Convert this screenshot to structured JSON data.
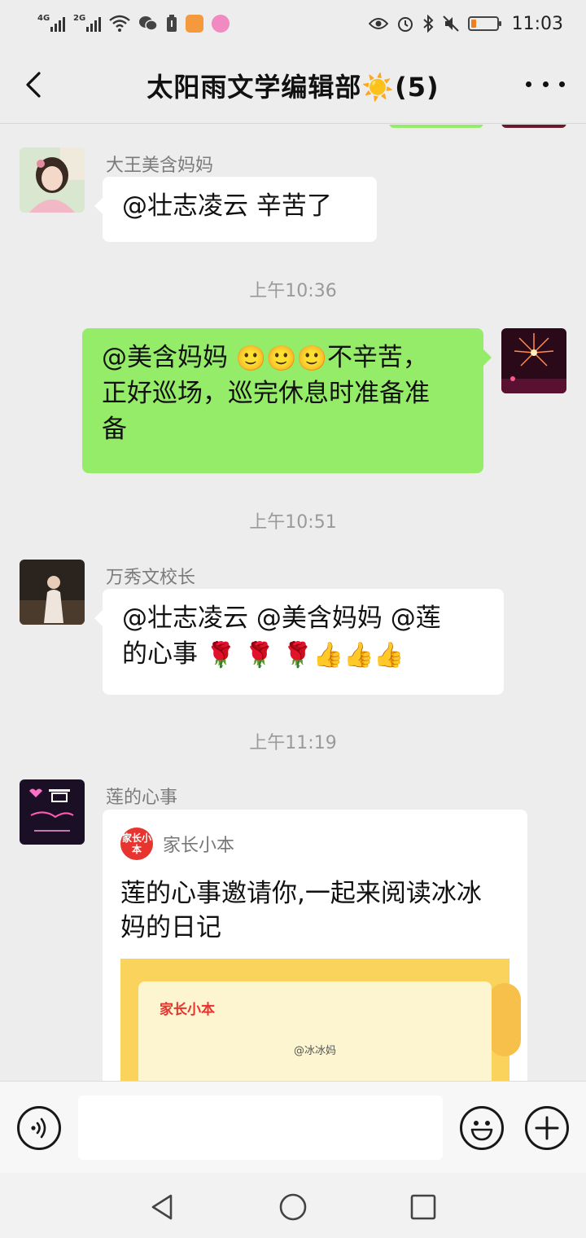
{
  "status_bar": {
    "net1": "4G",
    "net2": "2G",
    "time": "11:03",
    "battery_percent": 20,
    "battery_color": "#f07f22",
    "icons": [
      "signal-icon",
      "signal-icon",
      "wifi-icon",
      "wechat-icon",
      "battery-saver-icon",
      "uc-browser-icon",
      "app-badge-icon",
      "eye-icon",
      "alarm-icon",
      "bluetooth-icon",
      "mute-icon",
      "battery-icon"
    ]
  },
  "header": {
    "title": "太阳雨文学编辑部☀️(5)",
    "back_icon": "chevron-left-icon",
    "more_icon": "more-dots-icon"
  },
  "messages": [
    {
      "sender": "大王美含妈妈",
      "text": "@壮志凌云  辛苦了",
      "side": "left"
    },
    {
      "time": "上午10:36"
    },
    {
      "sender": "me",
      "text_line1": "@美含妈妈 ",
      "emojis1": [
        "🙂",
        "🙂",
        "🙂"
      ],
      "text_line1_end": "不辛苦，",
      "text_line2": "正好巡场，巡完休息时准备准",
      "text_line3": "备",
      "side": "right"
    },
    {
      "time": "上午10:51"
    },
    {
      "sender": "万秀文校长",
      "text_line1": "@壮志凌云  @美含妈妈  @莲",
      "text_line2": "的心事 ",
      "emojis": [
        "🌹",
        "🌹",
        "🌹",
        "👍",
        "👍",
        "👍"
      ],
      "side": "left"
    },
    {
      "time": "上午11:19"
    },
    {
      "sender": "莲的心事",
      "side": "left",
      "card": {
        "source_name": "家长小本",
        "logo_text": "家长小本",
        "title": "莲的心事邀请你,一起来阅读冰冰妈的日记",
        "thumb_brand": "家长小本",
        "thumb_handle": "@冰冰妈"
      }
    }
  ],
  "input_bar": {
    "placeholder": "",
    "voice_icon": "voice-icon",
    "emoji_icon": "emoji-icon",
    "plus_icon": "plus-icon"
  },
  "nav_bar": {
    "back_icon": "nav-back-icon",
    "home_icon": "nav-home-icon",
    "recent_icon": "nav-recent-icon"
  },
  "colors": {
    "background": "#ededed",
    "bubble_green": "#95ec69",
    "bubble_white": "#ffffff",
    "timestamp": "#9a9a9a"
  }
}
